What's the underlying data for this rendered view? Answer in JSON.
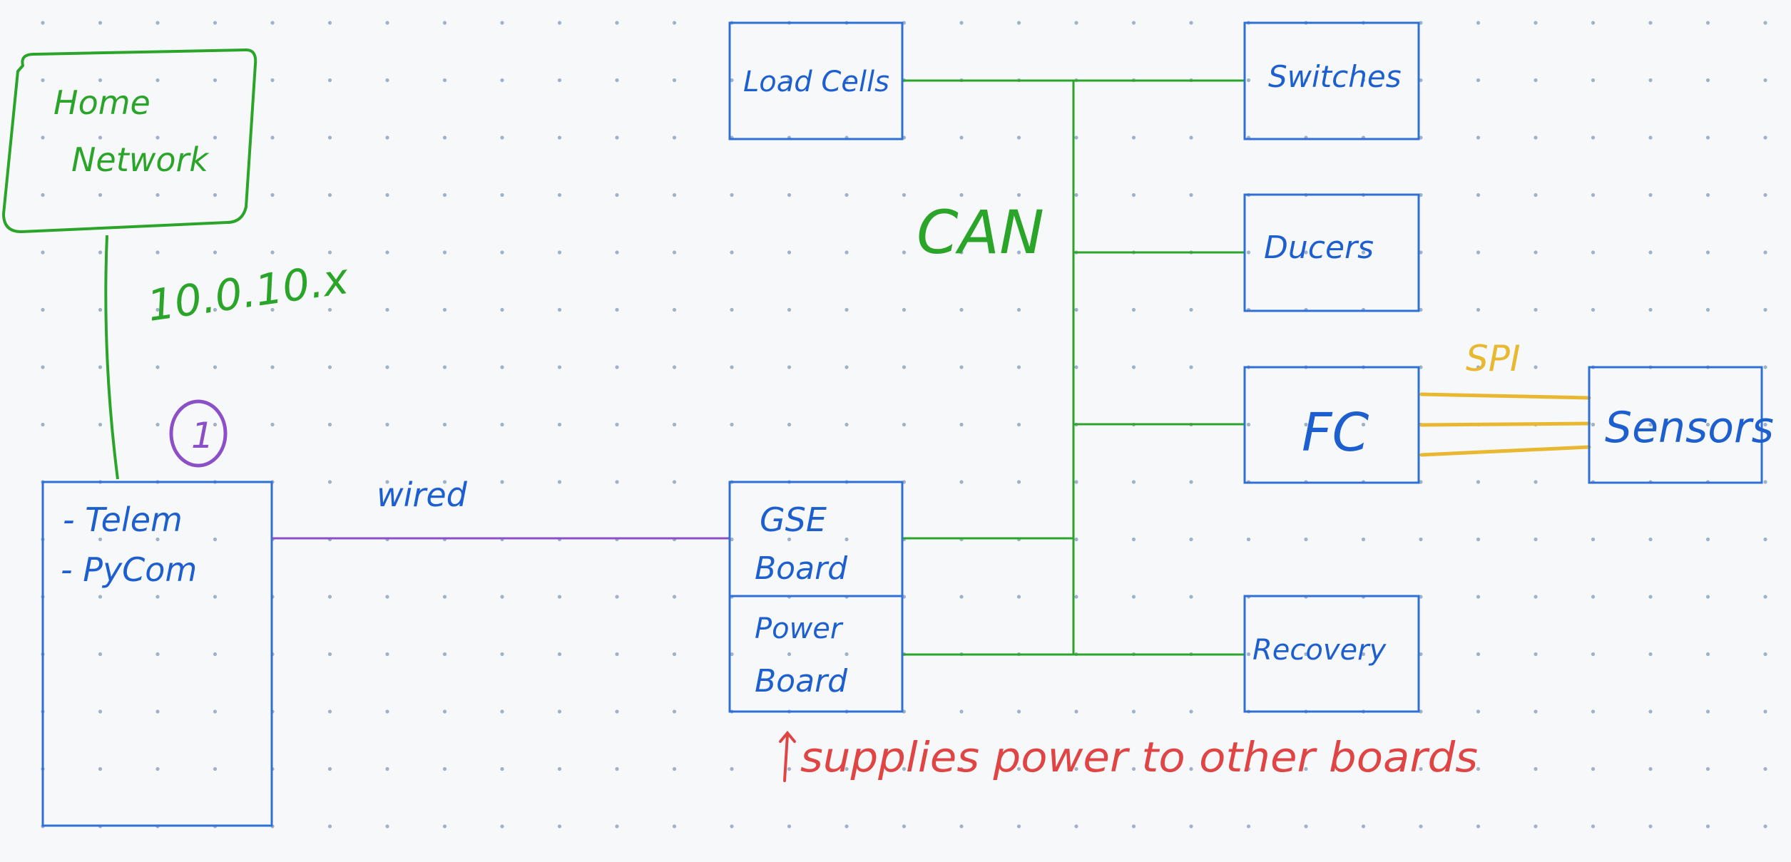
{
  "labels": {
    "home_network_line1": "Home",
    "home_network_line2": "Network",
    "ip": "10.0.10.x",
    "marker": "1",
    "computer_line1": "- Telem",
    "computer_line2": "- PyCom",
    "wired": "wired",
    "can": "CAN",
    "load_cells": "Load Cells",
    "switches": "Switches",
    "ducers": "Ducers",
    "fc": "FC",
    "sensors": "Sensors",
    "spi": "SPI",
    "gse_line1": "GSE",
    "gse_line2": "Board",
    "power_line1": "Power",
    "power_line2": "Board",
    "recovery": "Recovery",
    "power_note": "supplies power to other boards"
  },
  "colors": {
    "background": "#f7f8f9",
    "grid_dot": "#9fb2c9",
    "box_blue": "#2f6fd6",
    "text_blue": "#1e5fd0",
    "green": "#2aa52a",
    "purple": "#8b4fc7",
    "yellow": "#e8b830",
    "red": "#e04545"
  }
}
